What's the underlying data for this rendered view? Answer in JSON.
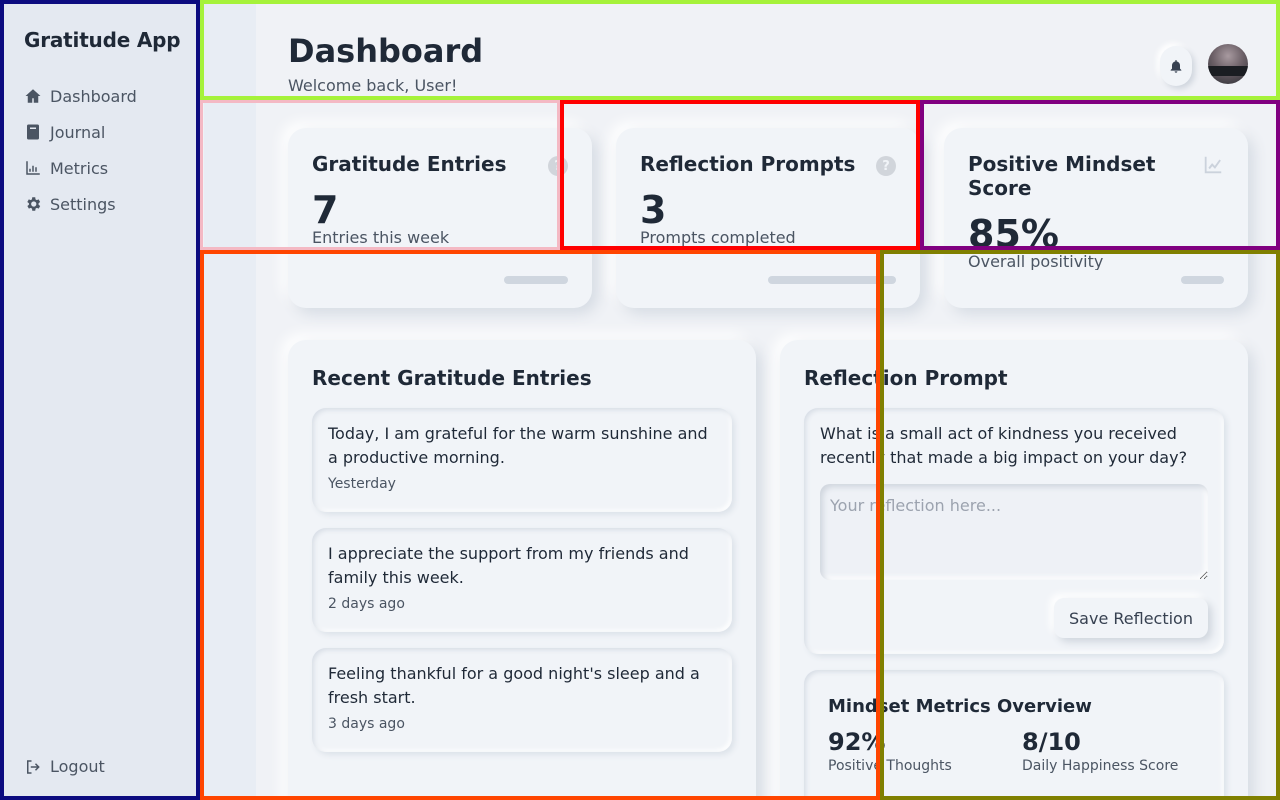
{
  "sidebar": {
    "brand": "Gratitude App",
    "items": [
      {
        "label": "Dashboard",
        "icon": "home-icon"
      },
      {
        "label": "Journal",
        "icon": "book-icon"
      },
      {
        "label": "Metrics",
        "icon": "chart-icon"
      },
      {
        "label": "Settings",
        "icon": "gear-icon"
      }
    ],
    "logout": "Logout"
  },
  "header": {
    "title": "Dashboard",
    "subtitle": "Welcome back, User!"
  },
  "stats": [
    {
      "title": "Gratitude Entries",
      "value": "7",
      "caption": "Entries this week",
      "icon": "help-icon",
      "progress": 0.25
    },
    {
      "title": "Reflection Prompts",
      "value": "3",
      "caption": "Prompts completed",
      "icon": "help-icon",
      "progress": 0.5
    },
    {
      "title": "Positive Mindset Score",
      "value": "85%",
      "caption": "Overall positivity",
      "icon": "chart-line-icon",
      "progress": 0.17
    }
  ],
  "recent": {
    "title": "Recent Gratitude Entries",
    "entries": [
      {
        "text": "Today, I am grateful for the warm sunshine and a productive morning.",
        "date": "Yesterday"
      },
      {
        "text": "I appreciate the support from my friends and family this week.",
        "date": "2 days ago"
      },
      {
        "text": "Feeling thankful for a good night's sleep and a fresh start.",
        "date": "3 days ago"
      }
    ]
  },
  "reflection": {
    "title": "Reflection Prompt",
    "prompt": "What is a small act of kindness you received recently that made a big impact on your day?",
    "placeholder": "Your reflection here...",
    "save_label": "Save Reflection"
  },
  "metrics": {
    "title": "Mindset Metrics Overview",
    "items": [
      {
        "value": "92%",
        "label": "Positive Thoughts"
      },
      {
        "value": "8/10",
        "label": "Daily Happiness Score"
      }
    ]
  },
  "colors": {
    "background": "#f0f2f6",
    "sidebar": "#e4e9f1",
    "text": "#1f2937",
    "muted": "#4b5563"
  }
}
